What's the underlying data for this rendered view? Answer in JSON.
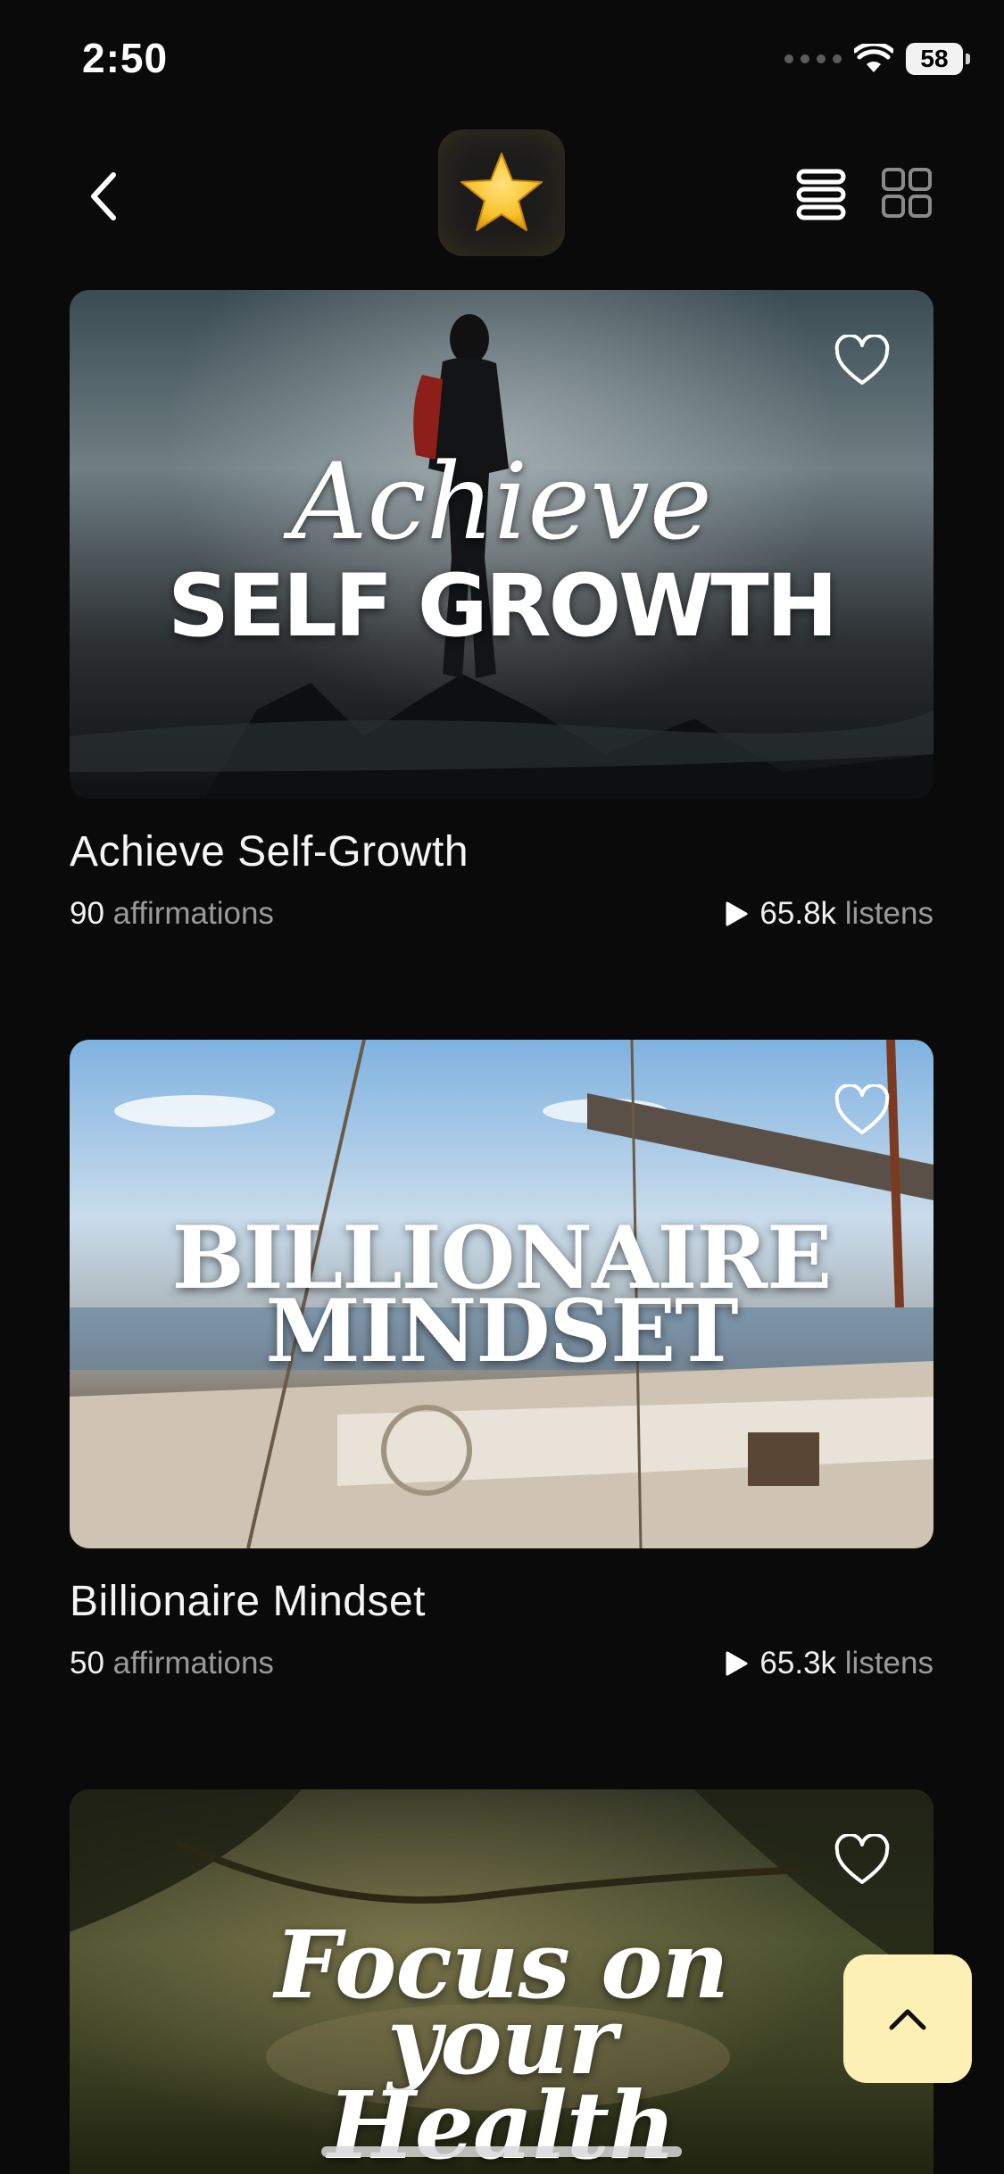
{
  "status_bar": {
    "time": "2:50",
    "battery": "58"
  },
  "header": {
    "back_icon": "chevron-left-icon",
    "badge_icon": "star-icon",
    "view_options": [
      "list-view-icon",
      "grid-view-icon"
    ]
  },
  "cards": [
    {
      "title": "Achieve Self-Growth",
      "image_script_text": "Achieve",
      "image_bold_text": "SELF GROWTH",
      "count": "90",
      "count_unit": "affirmations",
      "listens": "65.8k",
      "listens_unit": "listens"
    },
    {
      "title": "Billionaire Mindset",
      "image_line1": "BILLIONAIRE",
      "image_line2": "MINDSET",
      "count": "50",
      "count_unit": "affirmations",
      "listens": "65.3k",
      "listens_unit": "listens"
    },
    {
      "image_line1": "Focus on",
      "image_line2": "your",
      "image_line3": "Health"
    }
  ],
  "scroll_top_icon": "chevron-up-icon",
  "colors": {
    "background": "#0a0a0a",
    "scroll_button": "#fdf0b4",
    "star": "#f7c22b"
  }
}
